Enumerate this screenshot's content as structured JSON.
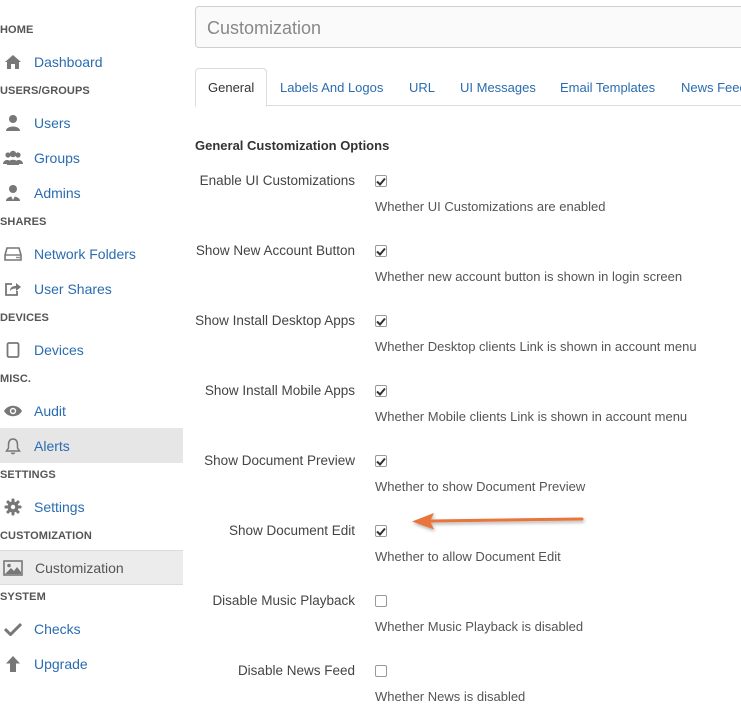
{
  "sidebar": {
    "sections": {
      "home": "HOME",
      "users_groups": "USERS/GROUPS",
      "shares": "SHARES",
      "devices": "DEVICES",
      "misc": "MISC.",
      "settings": "SETTINGS",
      "customization": "CUSTOMIZATION",
      "system": "SYSTEM"
    },
    "items": {
      "dashboard": "Dashboard",
      "users": "Users",
      "groups": "Groups",
      "admins": "Admins",
      "network_folders": "Network Folders",
      "user_shares": "User Shares",
      "devices": "Devices",
      "audit": "Audit",
      "alerts": "Alerts",
      "settings": "Settings",
      "customization": "Customization",
      "checks": "Checks",
      "upgrade": "Upgrade"
    }
  },
  "header": {
    "title": "Customization"
  },
  "tabs": [
    "General",
    "Labels And Logos",
    "URL",
    "UI Messages",
    "Email Templates",
    "News Feed"
  ],
  "active_tab": "General",
  "section_title": "General Customization Options",
  "options": [
    {
      "label": "Enable UI Customizations",
      "checked": true,
      "description": "Whether UI Customizations are enabled"
    },
    {
      "label": "Show New Account Button",
      "checked": true,
      "description": "Whether new account button is shown in login screen"
    },
    {
      "label": "Show Install Desktop Apps",
      "checked": true,
      "description": "Whether Desktop clients Link is shown in account menu"
    },
    {
      "label": "Show Install Mobile Apps",
      "checked": true,
      "description": "Whether Mobile clients Link is shown in account menu"
    },
    {
      "label": "Show Document Preview",
      "checked": true,
      "description": "Whether to show Document Preview"
    },
    {
      "label": "Show Document Edit",
      "checked": true,
      "description": "Whether to allow Document Edit"
    },
    {
      "label": "Disable Music Playback",
      "checked": false,
      "description": "Whether Music Playback is disabled"
    },
    {
      "label": "Disable News Feed",
      "checked": false,
      "description": "Whether News is disabled"
    }
  ],
  "colors": {
    "link": "#2a6cb0",
    "arrow": "#e8743b"
  }
}
